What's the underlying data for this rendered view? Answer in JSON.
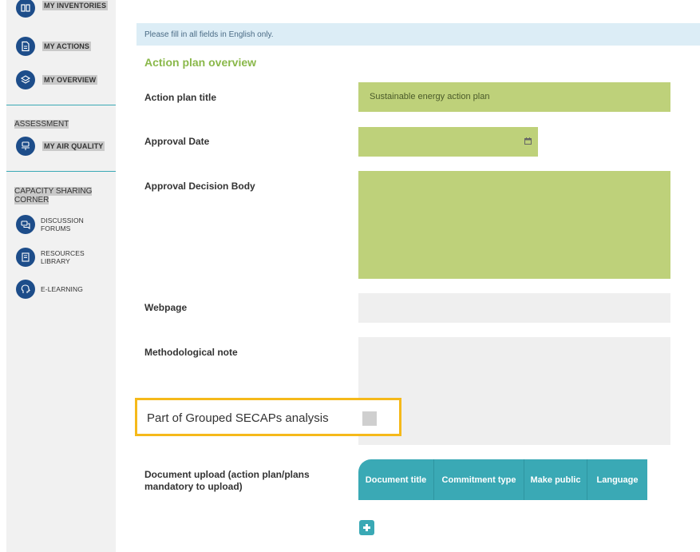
{
  "sidebar": {
    "top_items": [
      {
        "label": "MY INVENTORIES",
        "icon": "inventory-icon"
      },
      {
        "label": "MY ACTIONS",
        "icon": "document-icon"
      },
      {
        "label": "MY OVERVIEW",
        "icon": "layers-icon"
      }
    ],
    "assessment": {
      "title": "ASSESSMENT",
      "items": [
        {
          "label": "MY AIR QUALITY",
          "icon": "air-quality-icon"
        }
      ]
    },
    "capacity": {
      "title": "CAPACITY SHARING CORNER",
      "items": [
        {
          "label": "DISCUSSION FORUMS",
          "icon": "chat-icon"
        },
        {
          "label": "RESOURCES LIBRARY",
          "icon": "library-icon"
        },
        {
          "label": "E-LEARNING",
          "icon": "head-icon"
        }
      ]
    }
  },
  "form": {
    "notice": "Please fill in all fields in English only.",
    "section_title": "Action plan overview",
    "fields": {
      "title_label": "Action plan title",
      "title_value": "Sustainable energy action plan",
      "date_label": "Approval Date",
      "body_label": "Approval Decision Body",
      "webpage_label": "Webpage",
      "method_label": "Methodological note",
      "grouped_label": "Part of Grouped SECAPs analysis",
      "upload_label": "Document upload (action plan/plans mandatory to upload)"
    },
    "table_headers": [
      "Document title",
      "Commitment type",
      "Make public",
      "Language"
    ]
  },
  "colors": {
    "accent_teal": "#3aa9b5",
    "nav_blue": "#1d4d8a",
    "field_green": "#bed17a",
    "title_green": "#8ab84a",
    "highlight": "#f5b91a"
  }
}
